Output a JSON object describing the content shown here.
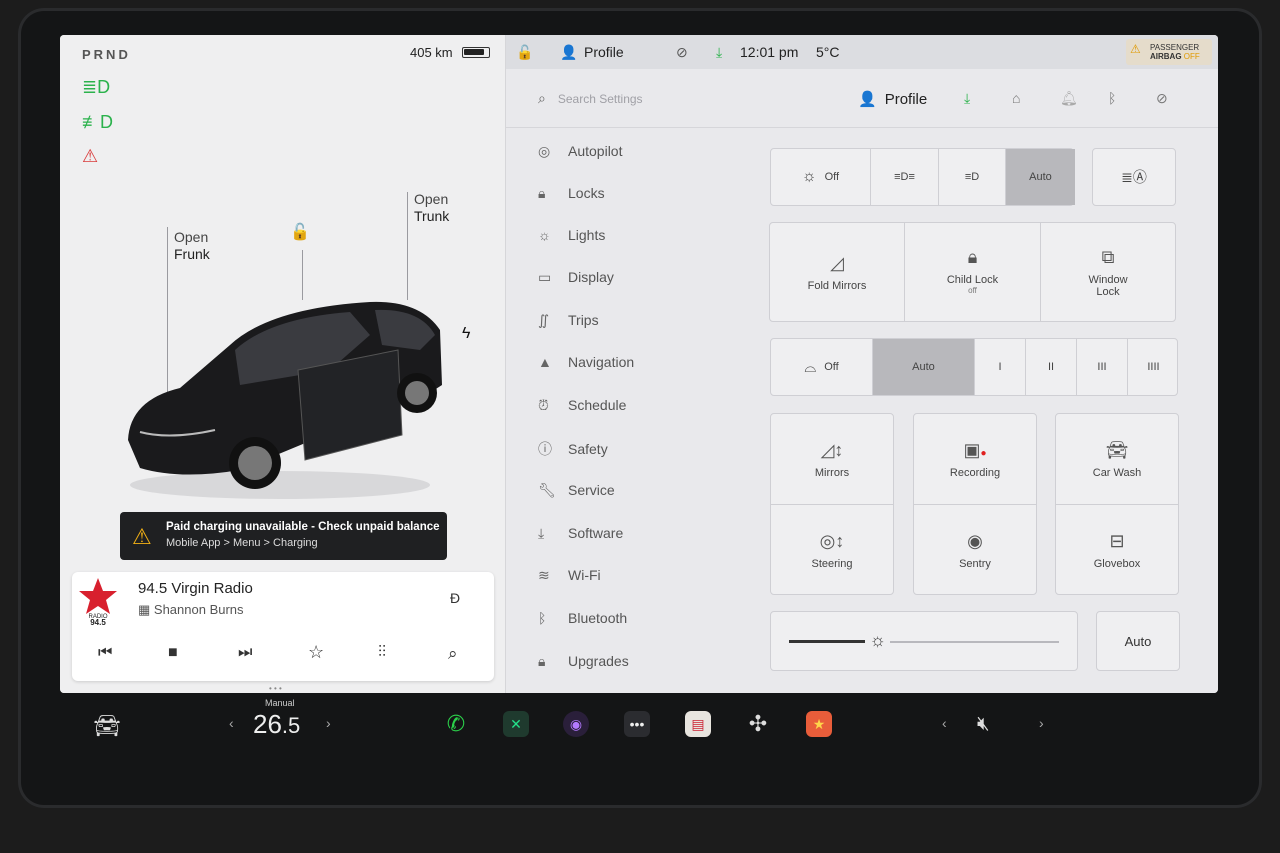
{
  "status": {
    "gear": "PRND",
    "range": "405 km",
    "profile": "Profile",
    "time": "12:01 pm",
    "temp": "5°C"
  },
  "airbag": {
    "line1": "PASSENGER",
    "line2": "AIRBAG",
    "line3": "OFF"
  },
  "car": {
    "frunk_a": "Open",
    "frunk_b": "Frunk",
    "trunk_a": "Open",
    "trunk_b": "Trunk"
  },
  "alert": {
    "title": "Paid charging unavailable - Check unpaid balance",
    "detail": "Mobile App > Menu > Charging"
  },
  "media": {
    "station": "94.5 Virgin Radio",
    "artist": "Shannon Burns",
    "logo_text": "RADIO",
    "logo_freq": "94.5"
  },
  "settings": {
    "search_placeholder": "Search Settings",
    "profile": "Profile",
    "menu": [
      "Autopilot",
      "Locks",
      "Lights",
      "Display",
      "Trips",
      "Navigation",
      "Schedule",
      "Safety",
      "Service",
      "Software",
      "Wi-Fi",
      "Bluetooth",
      "Upgrades"
    ]
  },
  "lights": {
    "off": "Off",
    "auto": "Auto"
  },
  "locks": {
    "fold": "Fold Mirrors",
    "child": "Child Lock",
    "child_state": "off",
    "window": "Window",
    "window2": "Lock"
  },
  "wipers": {
    "off": "Off",
    "auto": "Auto",
    "l1": "I",
    "l2": "II",
    "l3": "III",
    "l4": "IIII"
  },
  "tiles": {
    "mirrors": "Mirrors",
    "recording": "Recording",
    "carwash": "Car Wash",
    "steering": "Steering",
    "sentry": "Sentry",
    "glovebox": "Glovebox"
  },
  "brightness": {
    "auto": "Auto",
    "level": 0.32
  },
  "dock": {
    "temp_mode": "Manual",
    "temp_main": "26",
    "temp_dec": ".5"
  }
}
